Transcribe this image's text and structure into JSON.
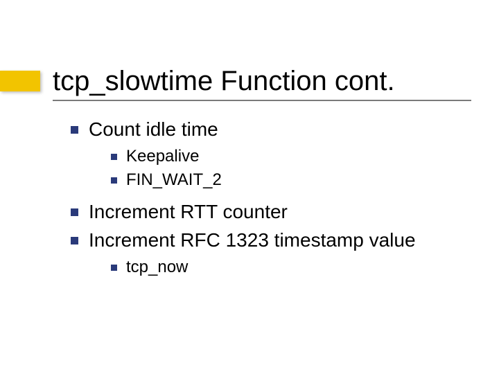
{
  "title": "tcp_slowtime Function cont.",
  "bullets": {
    "b1": "Count idle time",
    "b1_sub1": "Keepalive",
    "b1_sub2": "FIN_WAIT_2",
    "b2": "Increment RTT counter",
    "b3": "Increment RFC 1323 timestamp value",
    "b3_sub1": "tcp_now"
  }
}
